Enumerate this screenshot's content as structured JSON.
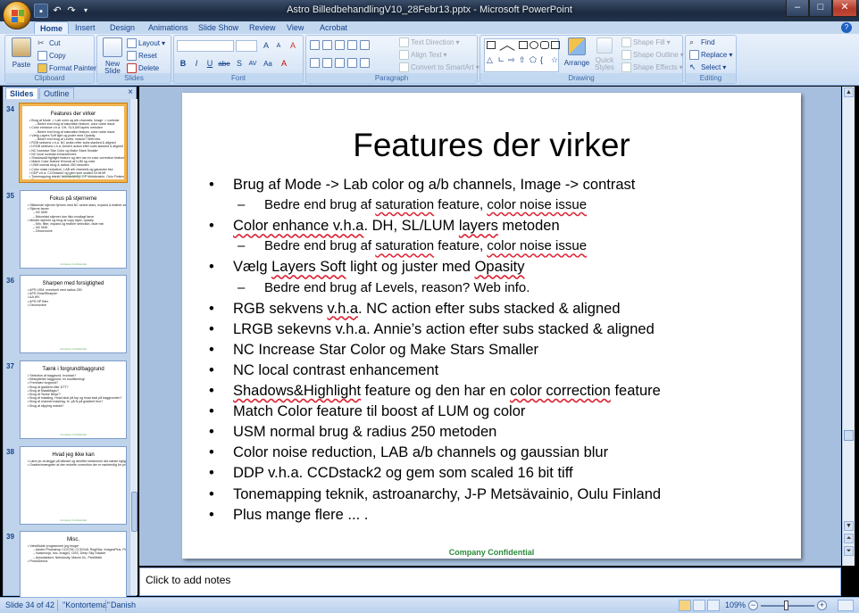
{
  "window": {
    "title": "Astro BilledbehandlingV10_28Febr13.pptx - Microsoft PowerPoint",
    "qat_save": "save",
    "qat_undo": "↶",
    "qat_redo": "↷"
  },
  "ribbon": {
    "tabs": [
      "Home",
      "Insert",
      "Design",
      "Animations",
      "Slide Show",
      "Review",
      "View",
      "Acrobat"
    ],
    "active_tab": "Home",
    "clipboard": {
      "label": "Clipboard",
      "paste": "Paste",
      "cut": "Cut",
      "copy": "Copy",
      "format_painter": "Format Painter"
    },
    "slides": {
      "label": "Slides",
      "new_slide": "New Slide",
      "layout": "Layout",
      "reset": "Reset",
      "delete": "Delete"
    },
    "font": {
      "label": "Font",
      "bold": "B",
      "italic": "I",
      "underline": "U",
      "strike": "abe",
      "shadow": "S",
      "spacing": "AV",
      "case": "Aa",
      "grow": "A",
      "shrink": "A",
      "clear": "A"
    },
    "paragraph": {
      "label": "Paragraph",
      "text_direction": "Text Direction",
      "align_text": "Align Text",
      "convert_smartart": "Convert to SmartArt"
    },
    "drawing": {
      "label": "Drawing",
      "arrange": "Arrange",
      "quick_styles": "Quick Styles",
      "shape_fill": "Shape Fill",
      "shape_outline": "Shape Outline",
      "shape_effects": "Shape Effects"
    },
    "editing": {
      "label": "Editing",
      "find": "Find",
      "replace": "Replace",
      "select": "Select"
    }
  },
  "pane": {
    "tab_slides": "Slides",
    "tab_outline": "Outline",
    "close": "×",
    "thumbnails": [
      {
        "num": "34",
        "title": "Features der virker",
        "lines": [
          "Brug af Mode -> Lab color og a/b channels, Image -> contrast",
          "– Bedre end brug af saturation feature, color noise issue",
          "Color enhance v.h.a. DH, SL/LUM layers metoden",
          "– Bedre end brug af saturation feature, color noise issue",
          "Vælg Layers Soft light og juster med Opasity",
          "– Bedre end brug af Levels, reason? Web info.",
          "RGB sekvens v.h.a. NC action efter subs stacked & aligned",
          "LRGB sekevns v.h.a. Annie's action efter subs stacked & aligned",
          "NC Increase Star Color og Make Stars Smaller",
          "NC local contrast enhancement",
          "Shadows&Highlight feature og den har en color correction feature",
          "Match Color feature til boost af LUM og color",
          "USM normal brug & radius 250 metoden",
          "Color noise reduction, LAB a/b channels og gaussian blur",
          "DDP v.h.a. CCDstack2 og gem som scaled 16 bit tiff",
          "Tonemapping teknik, astroanarchy, J-P Metsävainio, Oulu Finland",
          "Plus mange flere ... ."
        ]
      },
      {
        "num": "35",
        "title": "Fokus på stjernerne",
        "lines": [
          "Stikkende stjerner fjernes med NC select stars, expand & feather selection og Gaussian Blur",
          "Stjerne farver",
          "– NC M45",
          "– Beluelatd stjerner kan hiko modlagt farve",
          "Mindre stjerner og brug af copy layer, opacity",
          "– Min. filter, expand og feather selection, fade min",
          "– NC M45",
          "– Deconvolve"
        ]
      },
      {
        "num": "36",
        "title": "Sharpen med forsigtighed",
        "lines": [
          "APS USM, eventuelt med radius 250",
          "APS SmartSharpen",
          "AA WV",
          "APS HP filter",
          "Deconvolve"
        ]
      },
      {
        "num": "37",
        "title": "Tænk i forgrund/baggrund",
        "lines": [
          "Selection af baggrund, hvordan?",
          "Beskyttelse baggrund, en modificering!",
          "Fremhæv forgrund?",
          "Brug af gradient eller DTT?",
          "Brug af MaskMagic?",
          "Brug af 'Noise Ninja'?",
          "Brug af masking. Hvad skal på top og hvad skal på baggrunden?",
          "Brug af channel masking, fx. på N på gradient blur?",
          "Brug af clipping masks?"
        ]
      },
      {
        "num": "38",
        "title": "Hvad jeg ikke kan",
        "lines": [
          "Lære jer at lægge på billedet og derefter bestemme det næste rigtige processing step",
          "Graden/mængden af den enkelte correction der er nødvendig for processing step x til x+1"
        ]
      },
      {
        "num": "39",
        "title": "Misc.",
        "lines": [
          "Værdifulde programmer jeg bruger",
          "– Adobe Photoshop CC/CS5, CCDSoft, RegiStar, ImagesPlus, PixInsight",
          "– Noiseninja, Imc, ImageJ, DSS, Deep Sky Stacker",
          "– Autostakkert, Nebulosity, Maxim DL, PixelMath",
          "PhotoDenna"
        ]
      }
    ]
  },
  "slide": {
    "title": "Features der virker",
    "footer": "Company Confidential",
    "bullets": [
      {
        "level": 1,
        "dot": "•",
        "parts": [
          {
            "t": "Brug af Mode -> Lab color og a/b channels, Image -> contrast"
          }
        ]
      },
      {
        "level": 2,
        "dot": "–",
        "parts": [
          {
            "t": "Bedre end brug af "
          },
          {
            "t": "saturation",
            "sq": true
          },
          {
            "t": " feature, "
          },
          {
            "t": "color noise issue",
            "sq": true
          }
        ]
      },
      {
        "level": 1,
        "dot": "•",
        "parts": [
          {
            "t": "Color enhance v.h.a",
            "sq": true
          },
          {
            "t": ". DH, SL/LUM "
          },
          {
            "t": "layers",
            "sq": true
          },
          {
            "t": " metoden"
          }
        ]
      },
      {
        "level": 2,
        "dot": "–",
        "parts": [
          {
            "t": "Bedre end brug af "
          },
          {
            "t": "saturation",
            "sq": true
          },
          {
            "t": " feature, "
          },
          {
            "t": "color noise issue",
            "sq": true
          }
        ]
      },
      {
        "level": 1,
        "dot": "•",
        "parts": [
          {
            "t": "Vælg "
          },
          {
            "t": "Layers Soft",
            "sq": true
          },
          {
            "t": " light og juster med "
          },
          {
            "t": "Opasity",
            "sq": true
          }
        ]
      },
      {
        "level": 2,
        "dot": "–",
        "parts": [
          {
            "t": "Bedre end brug af Levels, reason? Web info."
          }
        ]
      },
      {
        "level": 1,
        "dot": "•",
        "parts": [
          {
            "t": "RGB sekvens "
          },
          {
            "t": "v.h.a",
            "sq": true
          },
          {
            "t": ". NC action efter subs stacked & aligned"
          }
        ]
      },
      {
        "level": 1,
        "dot": "•",
        "parts": [
          {
            "t": "LRGB sekevns v.h.a. Annie’s action efter subs stacked & aligned"
          }
        ]
      },
      {
        "level": 1,
        "dot": "•",
        "parts": [
          {
            "t": "NC Increase Star Color og Make Stars Smaller"
          }
        ]
      },
      {
        "level": 1,
        "dot": "•",
        "parts": [
          {
            "t": "NC local contrast enhancement"
          }
        ]
      },
      {
        "level": 1,
        "dot": "•",
        "parts": [
          {
            "t": "Shadows&Highlight",
            "sq": true
          },
          {
            "t": " feature og den har en "
          },
          {
            "t": "color correction",
            "sq": true
          },
          {
            "t": " feature"
          }
        ]
      },
      {
        "level": 1,
        "dot": "•",
        "parts": [
          {
            "t": "Match Color feature til boost af LUM og color"
          }
        ]
      },
      {
        "level": 1,
        "dot": "•",
        "parts": [
          {
            "t": "USM normal brug & radius 250 metoden"
          }
        ]
      },
      {
        "level": 1,
        "dot": "•",
        "parts": [
          {
            "t": "Color noise reduction, LAB a/b channels og gaussian blur"
          }
        ]
      },
      {
        "level": 1,
        "dot": "•",
        "parts": [
          {
            "t": "DDP v.h.a. CCDstack2 og gem som scaled 16 bit tiff"
          }
        ]
      },
      {
        "level": 1,
        "dot": "•",
        "parts": [
          {
            "t": "Tonemapping teknik, astroanarchy, J-P Metsävainio, Oulu Finland"
          }
        ]
      },
      {
        "level": 1,
        "dot": "•",
        "parts": [
          {
            "t": "Plus mange flere ... ."
          }
        ]
      }
    ]
  },
  "notes": {
    "placeholder": "Click to add notes"
  },
  "status": {
    "slide_info": "Slide 34 of 42",
    "theme": "\"Kontortema\"",
    "language": "Danish",
    "zoom": "109%",
    "zoom_minus": "−",
    "zoom_plus": "+"
  },
  "colors": {
    "accent": "#15428b",
    "selection": "#f2b350",
    "footer_green": "#2b8a3b",
    "squiggle": "#dd2233"
  }
}
